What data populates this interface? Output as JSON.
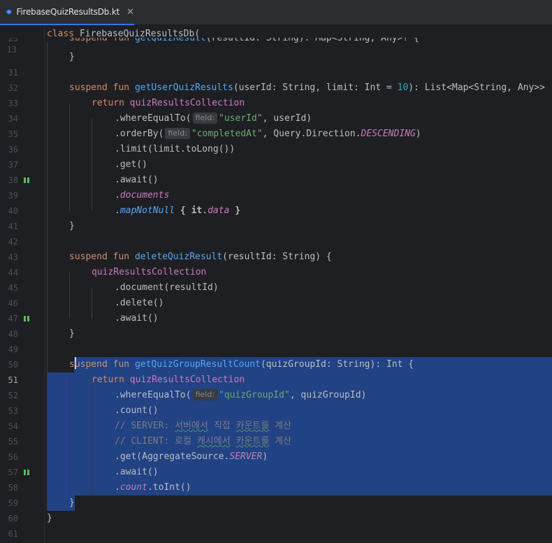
{
  "tab": {
    "filename": "FirebaseQuizResultsDb.kt",
    "close_glyph": "✕"
  },
  "sticky": {
    "line_no": "13",
    "code": "class FirebaseQuizResultsDb("
  },
  "lines": [
    {
      "n": "23",
      "html": "<span class='kw'>suspend fun</span> <span class='fn'>getQuizResult</span>(resultId: String): Map&lt;String, Any&gt;? {"
    },
    {
      "n": "31",
      "text": "    }"
    },
    {
      "n": "32",
      "text": ""
    },
    {
      "n": "33",
      "text": "suspend fun getUserQuizResults(userId: String, limit: Int = 10): List<Map<String, Any>>"
    },
    {
      "n": "34",
      "text": "return quizResultsCollection"
    },
    {
      "n": "35",
      "text": ".whereEqualTo( field: \"userId\", userId)"
    },
    {
      "n": "36",
      "text": ".orderBy( field: \"completedAt\", Query.Direction.DESCENDING)"
    },
    {
      "n": "37",
      "text": ".limit(limit.toLong())"
    },
    {
      "n": "38",
      "text": ".get()"
    },
    {
      "n": "39",
      "text": ".await()"
    },
    {
      "n": "40",
      "text": ".documents"
    },
    {
      "n": "41",
      "text": ".mapNotNull { it.data }"
    },
    {
      "n": "42",
      "text": "}"
    },
    {
      "n": "43",
      "text": ""
    },
    {
      "n": "44",
      "text": "suspend fun deleteQuizResult(resultId: String) {"
    },
    {
      "n": "45",
      "text": "quizResultsCollection"
    },
    {
      "n": "46",
      "text": ".document(resultId)"
    },
    {
      "n": "47",
      "text": ".delete()"
    },
    {
      "n": "48",
      "text": ".await()"
    },
    {
      "n": "49",
      "text": "}"
    },
    {
      "n": "50",
      "text": ""
    },
    {
      "n": "51",
      "text": "suspend fun getQuizGroupResultCount(quizGroupId: String): Int {"
    },
    {
      "n": "52",
      "text": "return quizResultsCollection"
    },
    {
      "n": "53",
      "text": ".whereEqualTo( field: \"quizGroupId\", quizGroupId)"
    },
    {
      "n": "54",
      "text": ".count()"
    },
    {
      "n": "55",
      "text": "// SERVER: 서버에서 직접 카운트를 계산"
    },
    {
      "n": "56",
      "text": "// CLIENT: 로컬 캐시에서 카운트를 계산"
    },
    {
      "n": "57",
      "text": ".get(AggregateSource.SERVER)"
    },
    {
      "n": "58",
      "text": ".await()"
    },
    {
      "n": "59",
      "text": ".count.toInt()"
    },
    {
      "n": "60",
      "text": "}"
    },
    {
      "n": "61",
      "text": "}"
    }
  ],
  "tokens": {
    "suspend": "suspend",
    "fun": "fun",
    "return": "return",
    "fn33": "getUserQuizResults",
    "fn44": "deleteQuizResult",
    "fn51": "getQuizGroupResultCount",
    "sig33a": "(userId: String, limit: Int = ",
    "num10": "10",
    "sig33b": "): List<Map<String, Any>>",
    "sig44": "(resultId: String) {",
    "sig51": "(quizGroupId: String): Int {",
    "coll": "quizResultsCollection",
    "whereEqualTo": ".whereEqualTo(",
    "hint_field": "field:",
    "userId_str": "\"userId\"",
    "userId_tail": ", userId)",
    "orderBy": ".orderBy(",
    "completedAt_str": "\"completedAt\"",
    "orderBy_mid": ", Query.Direction.",
    "descending": "DESCENDING",
    "close_paren": ")",
    "limit": ".limit(limit.toLong())",
    "get": ".get()",
    "await": ".await()",
    "dot": ".",
    "documents": "documents",
    "mapNotNull": "mapNotNull",
    "lambda_open": " { ",
    "it": "it",
    "data": "data",
    "lambda_close": " }",
    "document": ".document(resultId)",
    "delete": ".delete()",
    "group_str": "\"quizGroupId\"",
    "group_tail": ", quizGroupId)",
    "count": ".count()",
    "cm55a": "// SERVER: ",
    "cm55b": "서버에서",
    "cm55c": " 직접 ",
    "cm55d": "카운트를",
    "cm55e": " 계산",
    "cm56a": "// CLIENT: 로컬 ",
    "cm56b": "캐시에서",
    "cm56c": " ",
    "cm56d": "카운트를",
    "cm56e": " 계산",
    "getAgg": ".get(AggregateSource.",
    "server": "SERVER",
    "countProp": "count",
    "toInt": ".toInt()",
    "brace_close": "}",
    "s_rest": "uspend",
    "s_first": "s",
    "line31": "}",
    "line23": "suspend fun getQuizResult(resultId: String): Map<String, Any>? {"
  }
}
